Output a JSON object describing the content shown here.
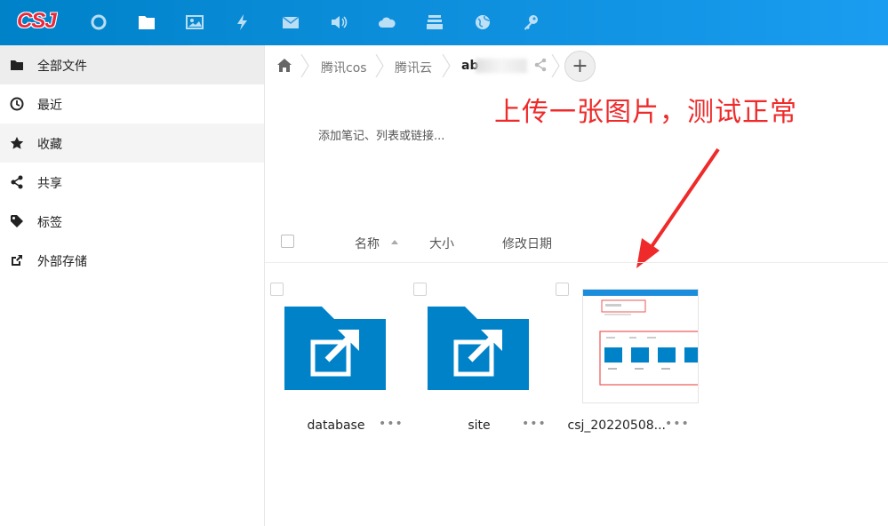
{
  "topbar": {
    "logo_text": "CSJ",
    "apps": [
      {
        "name": "dashboard-icon"
      },
      {
        "name": "files-icon"
      },
      {
        "name": "photos-icon"
      },
      {
        "name": "activity-icon"
      },
      {
        "name": "mail-icon"
      },
      {
        "name": "audio-icon"
      },
      {
        "name": "cloud-icon"
      },
      {
        "name": "deck-icon"
      },
      {
        "name": "globe-icon"
      },
      {
        "name": "key-icon"
      }
    ],
    "accent": "#0082c9"
  },
  "sidebar": {
    "items": [
      {
        "label": "全部文件",
        "icon": "folder-icon"
      },
      {
        "label": "最近",
        "icon": "clock-icon"
      },
      {
        "label": "收藏",
        "icon": "star-icon"
      },
      {
        "label": "共享",
        "icon": "share-icon"
      },
      {
        "label": "标签",
        "icon": "tag-icon"
      },
      {
        "label": "外部存储",
        "icon": "external-link-icon"
      }
    ]
  },
  "breadcrumb": {
    "items": [
      "腾讯cos",
      "腾讯云",
      "ab"
    ],
    "add_label": "+"
  },
  "notes_placeholder": "添加笔记、列表或链接...",
  "annotation": {
    "text": "上传一张图片，测试正常",
    "color": "#ef2a2a"
  },
  "columns": {
    "name": "名称",
    "size": "大小",
    "modified": "修改日期"
  },
  "files": [
    {
      "name": "database",
      "type": "external-folder",
      "more": "•••"
    },
    {
      "name": "site",
      "type": "external-folder",
      "more": "•••"
    },
    {
      "name": "csj_20220508...",
      "type": "image",
      "more": "•••"
    }
  ]
}
